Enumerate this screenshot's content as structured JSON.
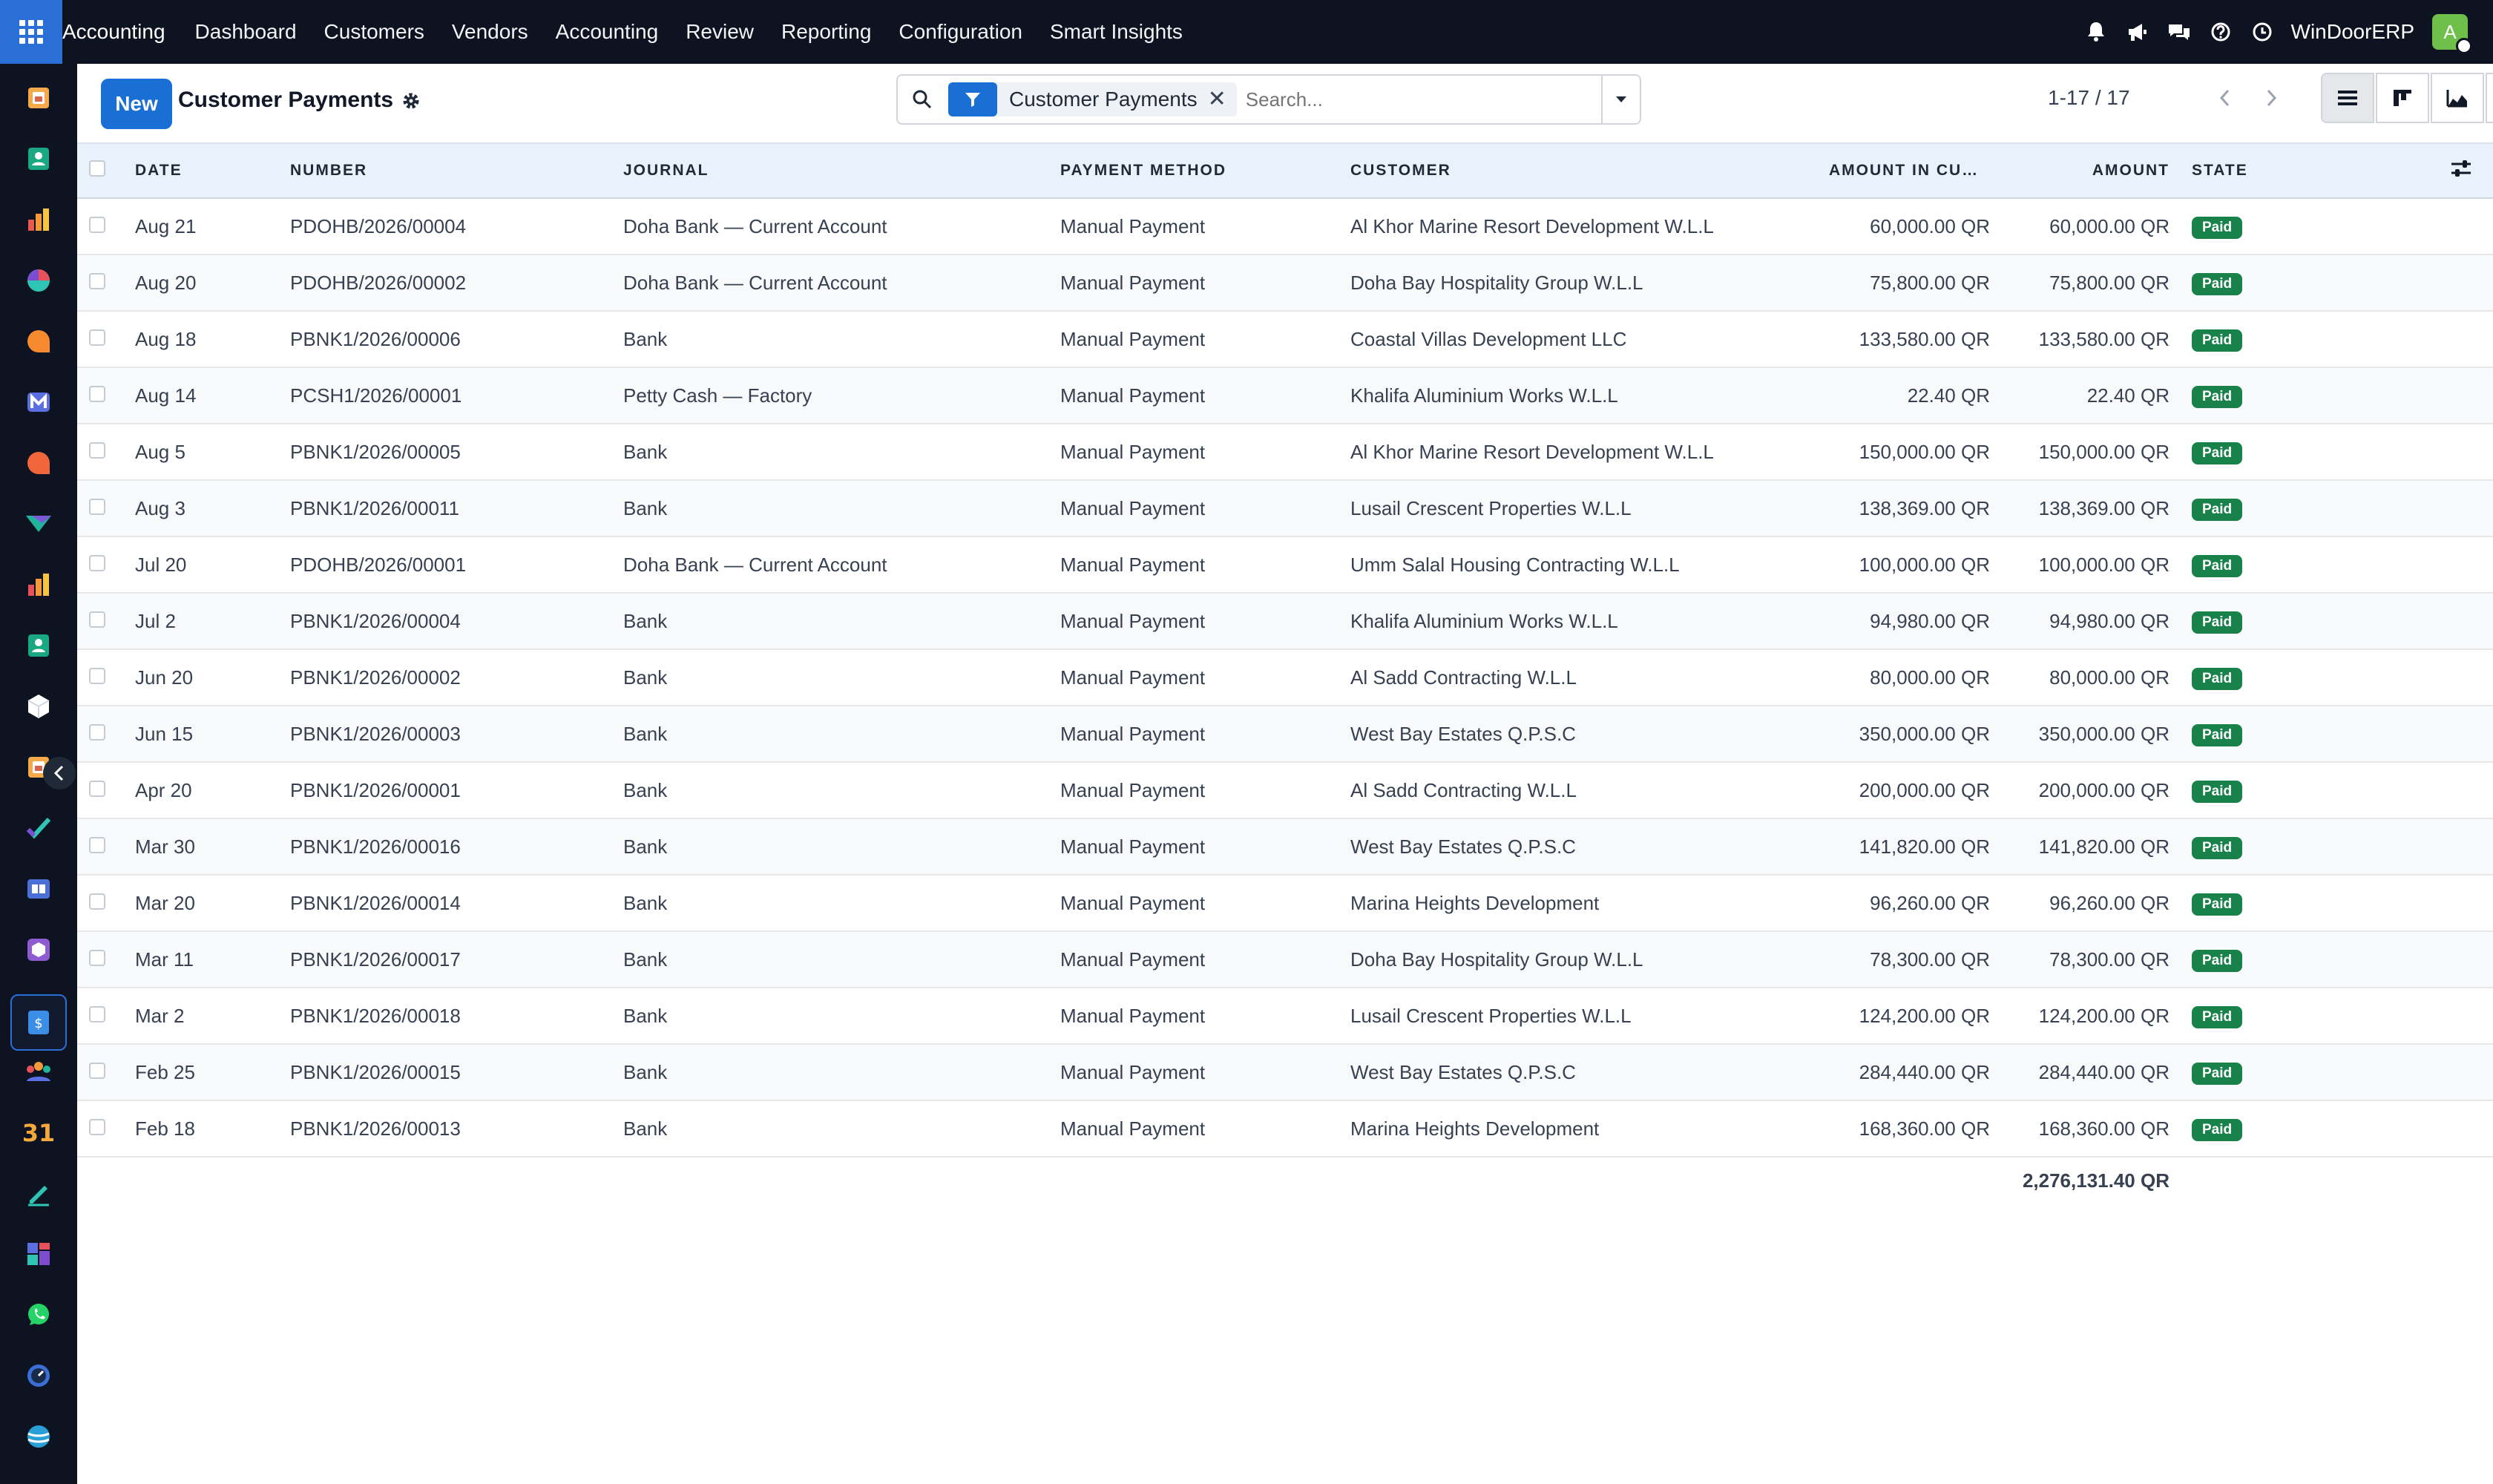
{
  "topbar": {
    "app_name": "Accounting",
    "menu": [
      "Dashboard",
      "Customers",
      "Vendors",
      "Accounting",
      "Review",
      "Reporting",
      "Configuration",
      "Smart Insights"
    ],
    "company": "WinDoorERP",
    "avatar_letter": "A"
  },
  "control": {
    "new_label": "New",
    "title": "Customer Payments",
    "facet_label": "Customer Payments",
    "search_placeholder": "Search...",
    "pager": "1-17 / 17"
  },
  "table": {
    "headers": {
      "date": "DATE",
      "number": "NUMBER",
      "journal": "JOURNAL",
      "payment_method": "PAYMENT METHOD",
      "customer": "CUSTOMER",
      "amount_currency": "AMOUNT IN CUR...",
      "amount": "AMOUNT",
      "state": "STATE"
    },
    "rows": [
      {
        "date": "Aug 21",
        "number": "PDOHB/2026/00004",
        "journal": "Doha Bank — Current Account",
        "method": "Manual Payment",
        "customer": "Al Khor Marine Resort Development W.L.L",
        "amount_currency": "60,000.00 QR",
        "amount": "60,000.00 QR",
        "state": "Paid"
      },
      {
        "date": "Aug 20",
        "number": "PDOHB/2026/00002",
        "journal": "Doha Bank — Current Account",
        "method": "Manual Payment",
        "customer": "Doha Bay Hospitality Group W.L.L",
        "amount_currency": "75,800.00 QR",
        "amount": "75,800.00 QR",
        "state": "Paid"
      },
      {
        "date": "Aug 18",
        "number": "PBNK1/2026/00006",
        "journal": "Bank",
        "method": "Manual Payment",
        "customer": "Coastal Villas Development LLC",
        "amount_currency": "133,580.00 QR",
        "amount": "133,580.00 QR",
        "state": "Paid"
      },
      {
        "date": "Aug 14",
        "number": "PCSH1/2026/00001",
        "journal": "Petty Cash — Factory",
        "method": "Manual Payment",
        "customer": "Khalifa Aluminium Works W.L.L",
        "amount_currency": "22.40 QR",
        "amount": "22.40 QR",
        "state": "Paid"
      },
      {
        "date": "Aug 5",
        "number": "PBNK1/2026/00005",
        "journal": "Bank",
        "method": "Manual Payment",
        "customer": "Al Khor Marine Resort Development W.L.L",
        "amount_currency": "150,000.00 QR",
        "amount": "150,000.00 QR",
        "state": "Paid"
      },
      {
        "date": "Aug 3",
        "number": "PBNK1/2026/00011",
        "journal": "Bank",
        "method": "Manual Payment",
        "customer": "Lusail Crescent Properties W.L.L",
        "amount_currency": "138,369.00 QR",
        "amount": "138,369.00 QR",
        "state": "Paid"
      },
      {
        "date": "Jul 20",
        "number": "PDOHB/2026/00001",
        "journal": "Doha Bank — Current Account",
        "method": "Manual Payment",
        "customer": "Umm Salal Housing Contracting W.L.L",
        "amount_currency": "100,000.00 QR",
        "amount": "100,000.00 QR",
        "state": "Paid"
      },
      {
        "date": "Jul 2",
        "number": "PBNK1/2026/00004",
        "journal": "Bank",
        "method": "Manual Payment",
        "customer": "Khalifa Aluminium Works W.L.L",
        "amount_currency": "94,980.00 QR",
        "amount": "94,980.00 QR",
        "state": "Paid"
      },
      {
        "date": "Jun 20",
        "number": "PBNK1/2026/00002",
        "journal": "Bank",
        "method": "Manual Payment",
        "customer": "Al Sadd Contracting W.L.L",
        "amount_currency": "80,000.00 QR",
        "amount": "80,000.00 QR",
        "state": "Paid"
      },
      {
        "date": "Jun 15",
        "number": "PBNK1/2026/00003",
        "journal": "Bank",
        "method": "Manual Payment",
        "customer": "West Bay Estates Q.P.S.C",
        "amount_currency": "350,000.00 QR",
        "amount": "350,000.00 QR",
        "state": "Paid"
      },
      {
        "date": "Apr 20",
        "number": "PBNK1/2026/00001",
        "journal": "Bank",
        "method": "Manual Payment",
        "customer": "Al Sadd Contracting W.L.L",
        "amount_currency": "200,000.00 QR",
        "amount": "200,000.00 QR",
        "state": "Paid"
      },
      {
        "date": "Mar 30",
        "number": "PBNK1/2026/00016",
        "journal": "Bank",
        "method": "Manual Payment",
        "customer": "West Bay Estates Q.P.S.C",
        "amount_currency": "141,820.00 QR",
        "amount": "141,820.00 QR",
        "state": "Paid"
      },
      {
        "date": "Mar 20",
        "number": "PBNK1/2026/00014",
        "journal": "Bank",
        "method": "Manual Payment",
        "customer": "Marina Heights Development",
        "amount_currency": "96,260.00 QR",
        "amount": "96,260.00 QR",
        "state": "Paid"
      },
      {
        "date": "Mar 11",
        "number": "PBNK1/2026/00017",
        "journal": "Bank",
        "method": "Manual Payment",
        "customer": "Doha Bay Hospitality Group W.L.L",
        "amount_currency": "78,300.00 QR",
        "amount": "78,300.00 QR",
        "state": "Paid"
      },
      {
        "date": "Mar 2",
        "number": "PBNK1/2026/00018",
        "journal": "Bank",
        "method": "Manual Payment",
        "customer": "Lusail Crescent Properties W.L.L",
        "amount_currency": "124,200.00 QR",
        "amount": "124,200.00 QR",
        "state": "Paid"
      },
      {
        "date": "Feb 25",
        "number": "PBNK1/2026/00015",
        "journal": "Bank",
        "method": "Manual Payment",
        "customer": "West Bay Estates Q.P.S.C",
        "amount_currency": "284,440.00 QR",
        "amount": "284,440.00 QR",
        "state": "Paid"
      },
      {
        "date": "Feb 18",
        "number": "PBNK1/2026/00013",
        "journal": "Bank",
        "method": "Manual Payment",
        "customer": "Marina Heights Development",
        "amount_currency": "168,360.00 QR",
        "amount": "168,360.00 QR",
        "state": "Paid"
      }
    ],
    "total_amount": "2,276,131.40 QR"
  },
  "colors": {
    "topbar_bg": "#0d1321",
    "accent": "#1a6fd4",
    "paid_badge": "#18824a",
    "header_bg": "#e9f2fb"
  },
  "rail_icons": [
    "documents-app-icon",
    "contacts-app-icon",
    "sales-chart-app-icon",
    "dashboard-pie-app-icon",
    "discuss-bubble-app-icon",
    "mail-app-icon",
    "chat-bubble-app-icon",
    "project-arrow-app-icon",
    "reporting-bars-app-icon",
    "employees-app-icon",
    "inventory-box-app-icon",
    "documents-alt-app-icon",
    "todo-check-app-icon",
    "knowledge-book-app-icon",
    "purchase-cube-app-icon",
    "accounting-invoice-app-icon",
    "team-app-icon",
    "calendar-app-icon",
    "sign-pen-app-icon",
    "apps-grid-app-icon",
    "whatsapp-app-icon",
    "timesheet-clock-app-icon",
    "website-globe-app-icon"
  ]
}
